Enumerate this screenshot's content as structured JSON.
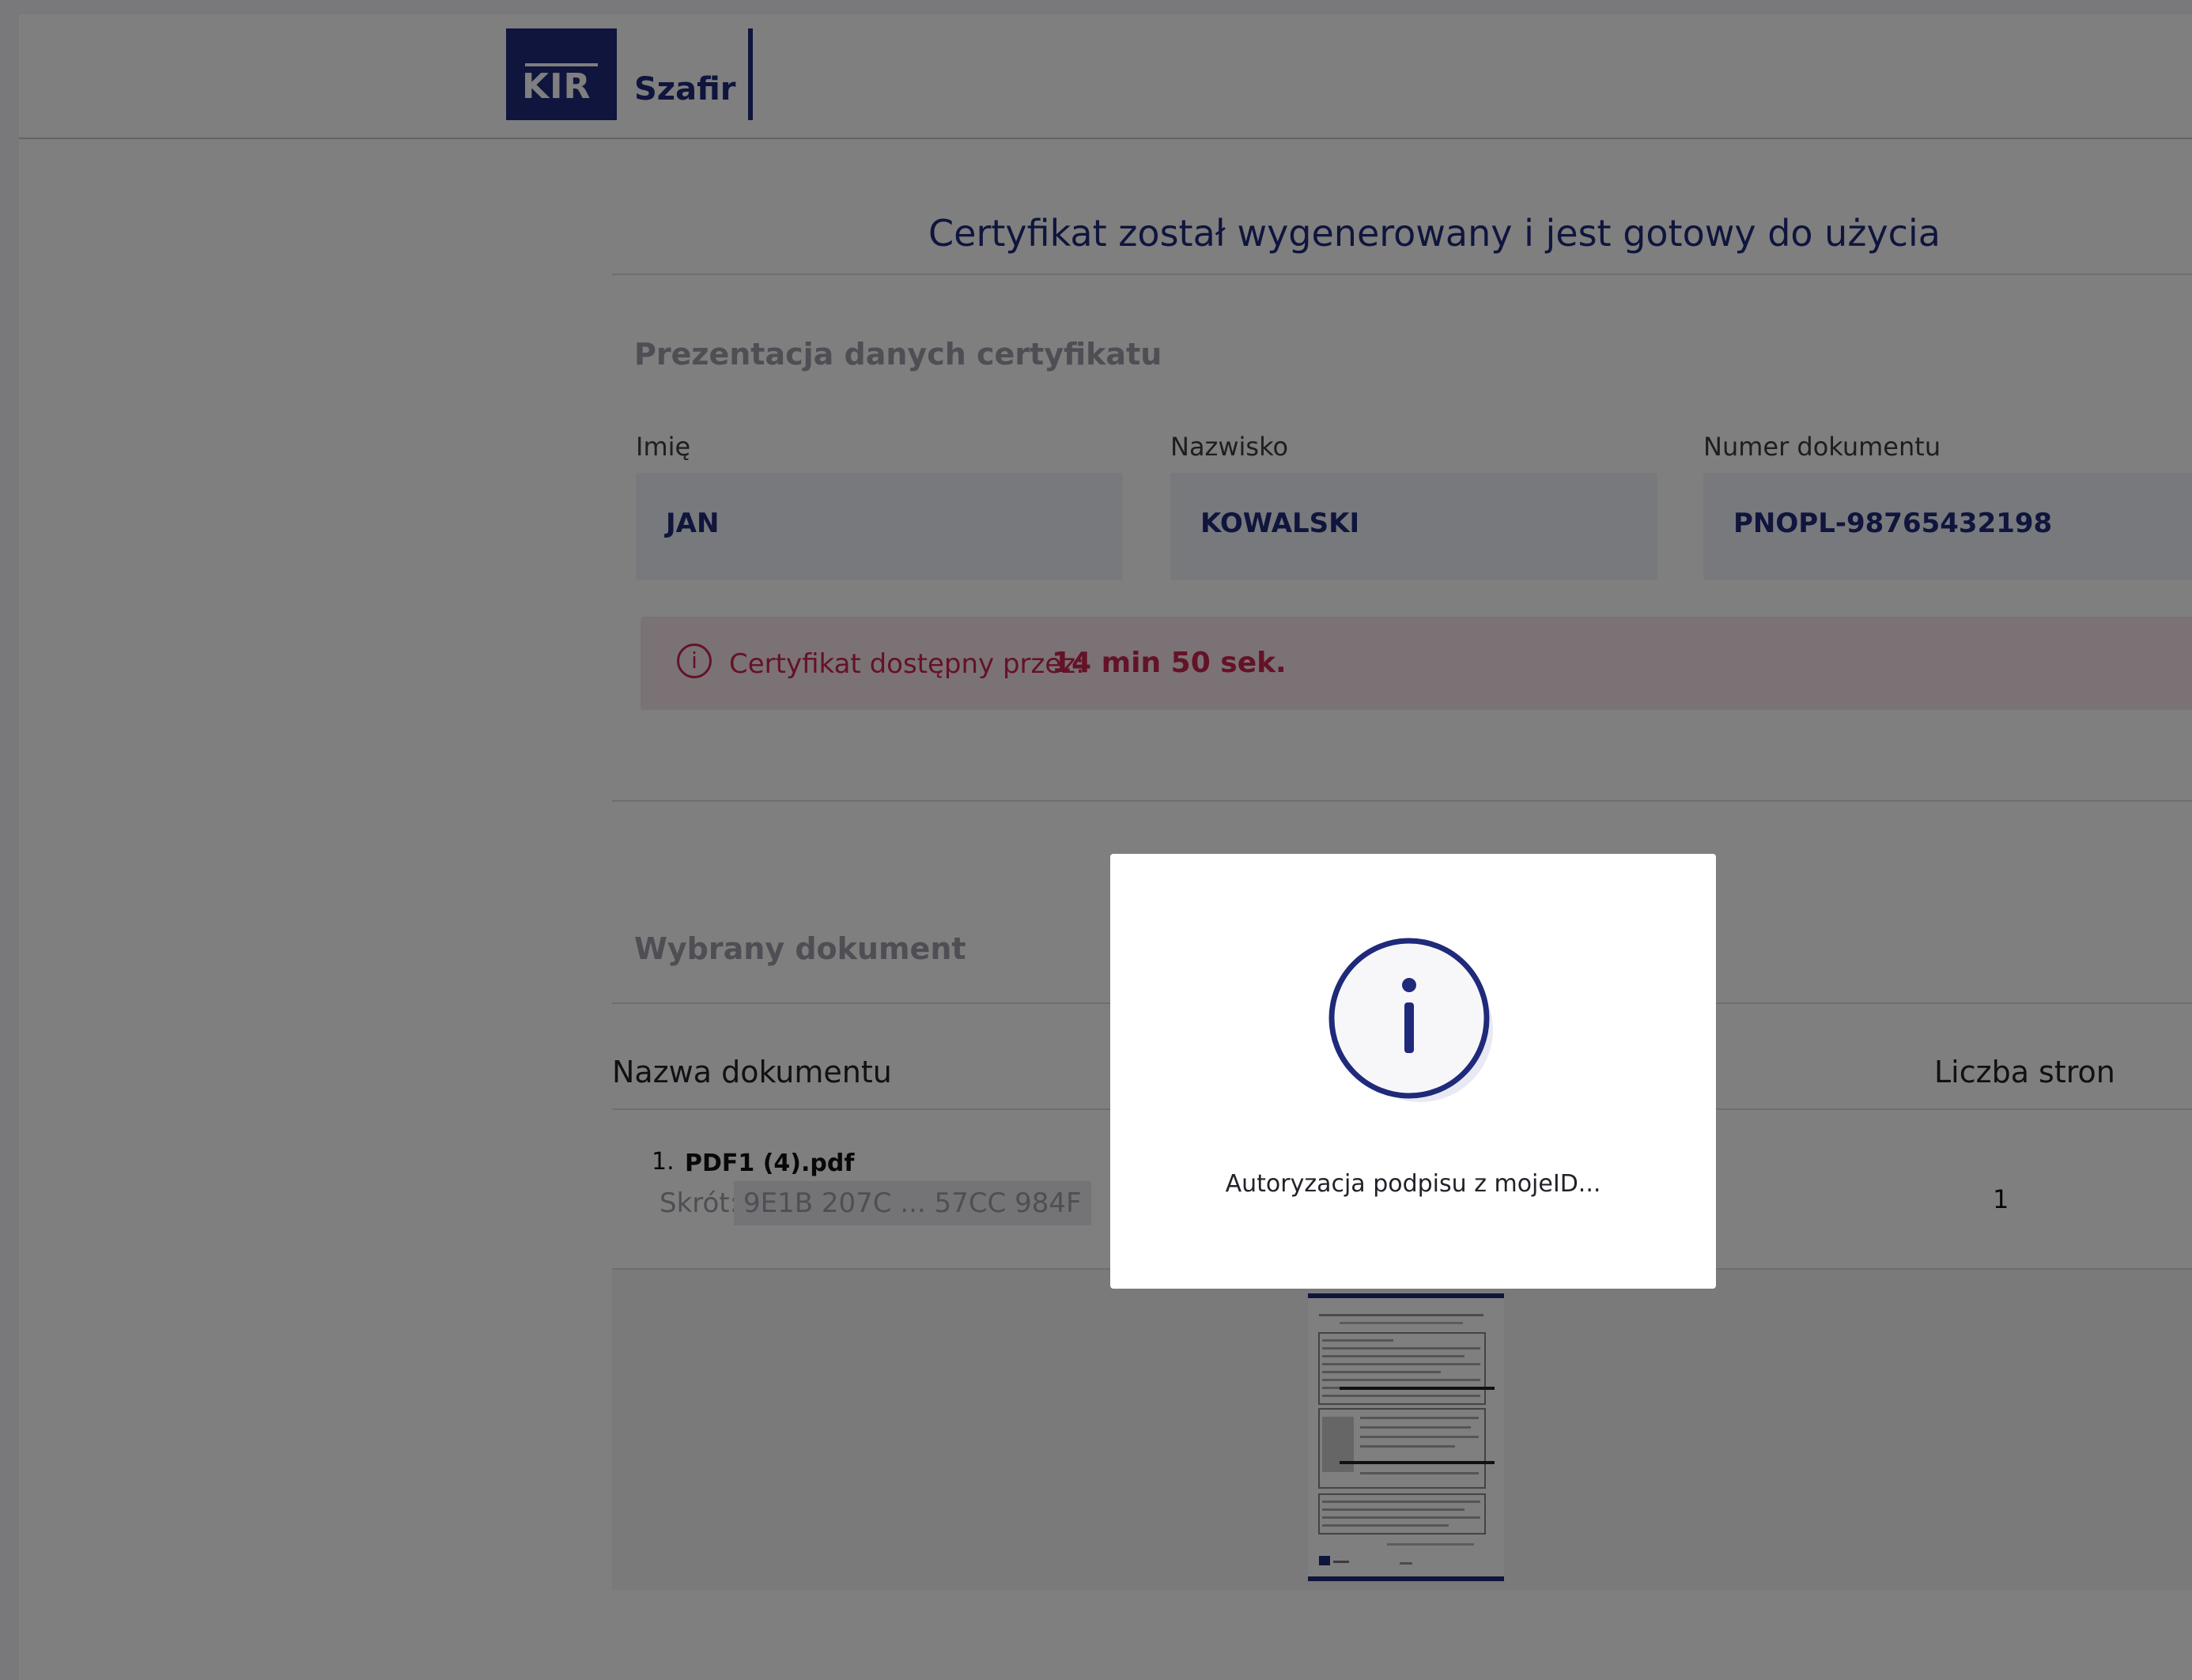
{
  "header": {
    "logo_kir": "KIR",
    "logo_szafir": "Szafir"
  },
  "main": {
    "title": "Certyfikat został wygenerowany i jest gotowy do użycia",
    "cert_section_title": "Prezentacja danych certyfikatu",
    "fields": [
      {
        "label": "Imię",
        "value": "JAN"
      },
      {
        "label": "Nazwisko",
        "value": "KOWALSKI"
      },
      {
        "label": "Numer dokumentu",
        "value": "PNOPL-98765432198"
      }
    ],
    "alert": {
      "icon": "info-icon",
      "text": "Certyfikat dostępny przez:",
      "value": "14 min 50 sek."
    },
    "document_section_title": "Wybrany dokument",
    "table": {
      "headers": [
        "Nazwa dokumentu",
        "Liczba stron"
      ],
      "rows": [
        {
          "index": "1.",
          "name": "PDF1 (4).pdf",
          "hash_label": "Skrót:",
          "hash": "9E1B 207C ... 57CC 984F",
          "pages": "1"
        }
      ]
    }
  },
  "modal": {
    "icon": "info-icon",
    "text": "Autoryzacja podpisu z mojeID..."
  },
  "colors": {
    "brand": "#1f2a7a",
    "alert": "#c8244f",
    "overlay": "rgba(0,0,0,0.5)"
  }
}
